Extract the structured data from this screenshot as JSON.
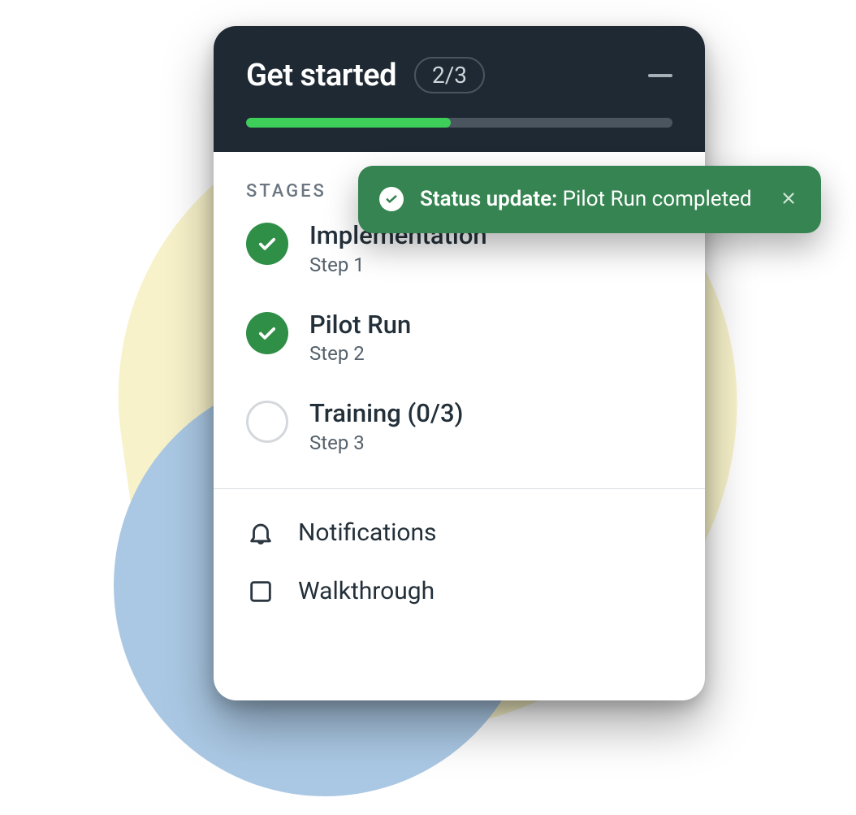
{
  "header": {
    "title": "Get started",
    "counter": "2/3",
    "progress_percent": 48
  },
  "section_label": "STAGES",
  "stages": [
    {
      "title": "Implementation",
      "sub": "Step 1",
      "done": true
    },
    {
      "title": "Pilot Run",
      "sub": "Step 2",
      "done": true
    },
    {
      "title": "Training (0/3)",
      "sub": "Step 3",
      "done": false
    }
  ],
  "footer": {
    "items": [
      {
        "icon": "bell-icon",
        "label": "Notifications"
      },
      {
        "icon": "walkthrough-icon",
        "label": "Walkthrough"
      }
    ]
  },
  "toast": {
    "prefix": "Status update:",
    "message": "Pilot Run completed"
  },
  "colors": {
    "header_bg": "#1f2933",
    "accent_green": "#3ecf5b",
    "stage_done": "#2f8f46",
    "toast_bg": "#358451"
  }
}
